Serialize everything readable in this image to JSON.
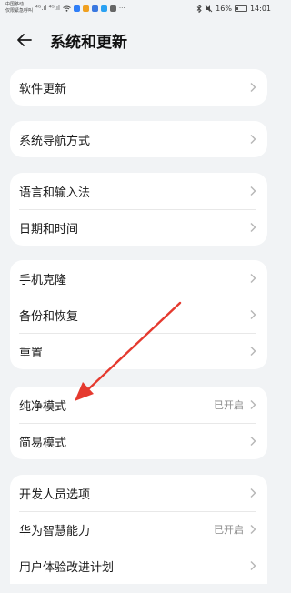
{
  "status_bar": {
    "carrier_line1": "中国移动",
    "carrier_line2": "仅限紧急呼叫",
    "signal": "⁴ᴳ.ıl ⁴ᴳ.ıl",
    "battery": "16%",
    "time": "14:01"
  },
  "header": {
    "title": "系统和更新"
  },
  "groups": [
    {
      "items": [
        {
          "label": "软件更新"
        }
      ]
    },
    {
      "items": [
        {
          "label": "系统导航方式"
        }
      ]
    },
    {
      "items": [
        {
          "label": "语言和输入法"
        },
        {
          "label": "日期和时间"
        }
      ]
    },
    {
      "items": [
        {
          "label": "手机克隆"
        },
        {
          "label": "备份和恢复"
        },
        {
          "label": "重置"
        }
      ]
    },
    {
      "items": [
        {
          "label": "纯净模式",
          "status": "已开启"
        },
        {
          "label": "简易模式"
        }
      ]
    },
    {
      "items": [
        {
          "label": "开发人员选项"
        },
        {
          "label": "华为智慧能力",
          "status": "已开启"
        },
        {
          "label": "用户体验改进计划"
        }
      ]
    }
  ],
  "colors": {
    "background": "#f1f3f5",
    "card": "#ffffff",
    "annotation_arrow": "#e53a2f"
  }
}
